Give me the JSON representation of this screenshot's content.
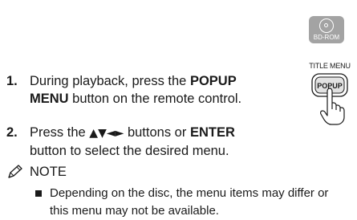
{
  "badge": {
    "label": "BD-ROM",
    "icon": "disc-icon",
    "color": "#a3a3a3"
  },
  "steps": [
    {
      "number": "1.",
      "line1_pre": "During playback, press the ",
      "line1_bold": "POPUP",
      "line2_bold": "MENU",
      "line2_post": " button on the remote control."
    },
    {
      "number": "2.",
      "line1_pre": "Press the ",
      "line1_arrows": "▲▼◄►",
      "line1_mid": " buttons or ",
      "line1_bold": "ENTER",
      "line2": "button to select the desired menu."
    }
  ],
  "remote_illustration": {
    "caption": "TITLE MENU",
    "button_label": "POPUP",
    "icon": "hand-press-icon"
  },
  "note": {
    "icon": "pencil-note-icon",
    "heading": "NOTE",
    "items": [
      {
        "line1": "Depending on the disc, the menu items may differ or",
        "line2": "this menu may not be available."
      }
    ]
  }
}
